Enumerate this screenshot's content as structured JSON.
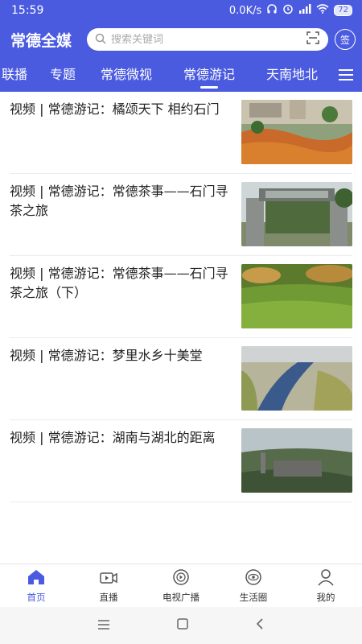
{
  "status_bar": {
    "time": "15:59",
    "speed": "0.0K/s",
    "battery": "72"
  },
  "header": {
    "logo": "常德全媒",
    "search_placeholder": "搜索关键词",
    "sign_label": "签"
  },
  "tabs": [
    "联播",
    "专题",
    "常德微视",
    "常德游记",
    "天南地北"
  ],
  "active_tab": "常德游记",
  "articles": [
    {
      "title": "视频 | 常德游记：橘颂天下 相约石门"
    },
    {
      "title": "视频 | 常德游记：常德茶事——石门寻茶之旅"
    },
    {
      "title": "视频 | 常德游记：常德茶事——石门寻茶之旅（下）"
    },
    {
      "title": "视频 | 常德游记：梦里水乡十美堂"
    },
    {
      "title": "视频 | 常德游记：湖南与湖北的距离"
    }
  ],
  "bottom_nav": [
    {
      "label": "首页",
      "icon": "home-icon",
      "active": true
    },
    {
      "label": "直播",
      "icon": "live-camera-icon"
    },
    {
      "label": "电视广播",
      "icon": "tv-broadcast-icon"
    },
    {
      "label": "生活圈",
      "icon": "life-circle-icon"
    },
    {
      "label": "我的",
      "icon": "user-icon"
    }
  ],
  "colors": {
    "primary": "#4a5be0"
  }
}
